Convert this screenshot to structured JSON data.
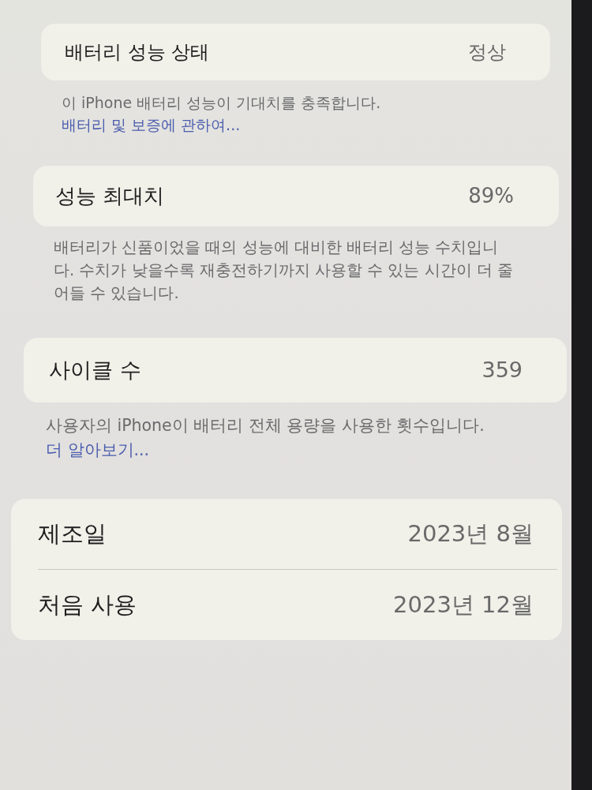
{
  "sections": [
    {
      "rows": [
        {
          "label": "배터리 성능 상태",
          "value": "정상"
        }
      ],
      "footer": {
        "text": "이 iPhone 배터리 성능이 기대치를 충족합니다.",
        "link": "배터리 및 보증에 관하여..."
      }
    },
    {
      "rows": [
        {
          "label": "성능 최대치",
          "value": "89%"
        }
      ],
      "footer": {
        "text": "배터리가 신품이었을 때의 성능에 대비한 배터리 성능 수치입니다. 수치가 낮을수록 재충전하기까지 사용할 수 있는 시간이 더 줄어들 수 있습니다."
      }
    },
    {
      "rows": [
        {
          "label": "사이클 수",
          "value": "359"
        }
      ],
      "footer": {
        "text": "사용자의 iPhone이 배터리 전체 용량을 사용한 횟수입니다.",
        "link": "더 알아보기..."
      }
    },
    {
      "rows": [
        {
          "label": "제조일",
          "value": "2023년 8월"
        },
        {
          "label": "처음 사용",
          "value": "2023년 12월"
        }
      ]
    }
  ]
}
